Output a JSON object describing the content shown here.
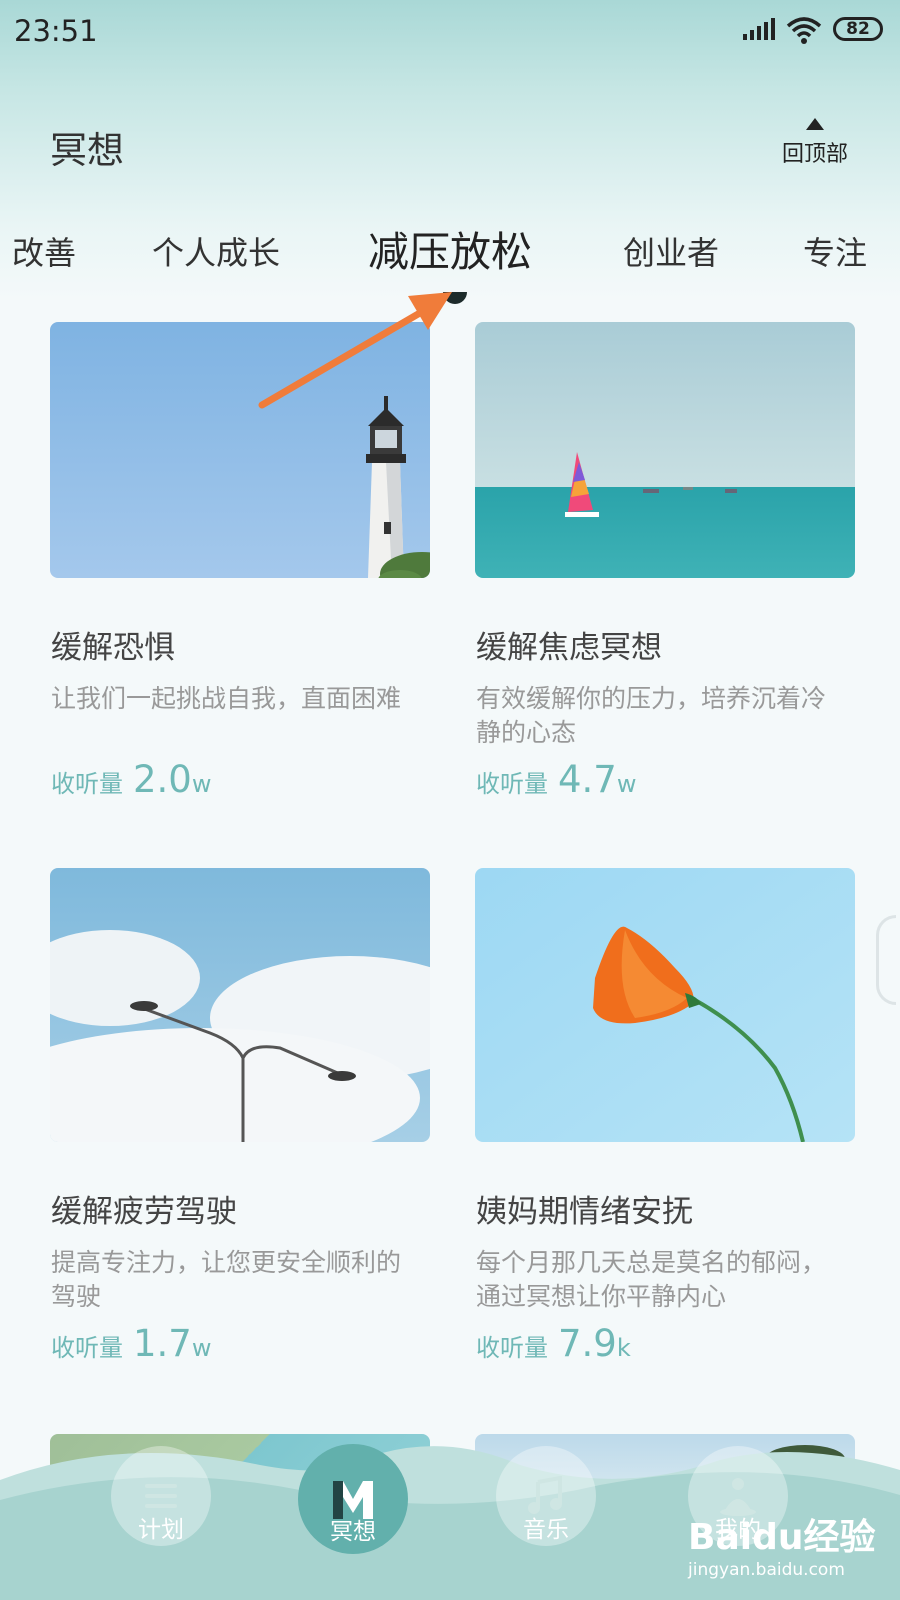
{
  "status_bar": {
    "time": "23:51",
    "battery": "82"
  },
  "header": {
    "title": "冥想",
    "back_to_top": "回顶部"
  },
  "tabs": [
    {
      "label": "改善"
    },
    {
      "label": "个人成长"
    },
    {
      "label": "减压放松",
      "active": true
    },
    {
      "label": "创业者"
    },
    {
      "label": "专注"
    }
  ],
  "cards": [
    {
      "title": "缓解恐惧",
      "desc": "让我们一起挑战自我，直面困难",
      "count_label": "收听量",
      "count_value": "2.0",
      "count_unit": "w",
      "image": "lighthouse"
    },
    {
      "title": "缓解焦虑冥想",
      "desc": "有效缓解你的压力，培养沉着冷静的心态",
      "count_label": "收听量",
      "count_value": "4.7",
      "count_unit": "w",
      "image": "sailboat"
    },
    {
      "title": "缓解疲劳驾驶",
      "desc": "提高专注力，让您更安全顺利的驾驶",
      "count_label": "收听量",
      "count_value": "1.7",
      "count_unit": "w",
      "image": "streetlamp"
    },
    {
      "title": "姨妈期情绪安抚",
      "desc": "每个月那几天总是莫名的郁闷，通过冥想让你平静内心",
      "count_label": "收听量",
      "count_value": "7.9",
      "count_unit": "k",
      "image": "poppy-flower"
    }
  ],
  "bottom_nav": [
    {
      "label": "计划",
      "icon": "menu-icon"
    },
    {
      "label": "冥想",
      "icon": "m-logo-icon",
      "active": true
    },
    {
      "label": "音乐",
      "icon": "music-note-icon"
    },
    {
      "label": "我的",
      "icon": "meditation-person-icon"
    }
  ],
  "watermark": {
    "brand": "Baidu经验",
    "url": "jingyan.baidu.com"
  },
  "colors": {
    "accent": "#6fb8b6",
    "header_bg": "#a9d8d6",
    "nav_active": "#62b0ac",
    "annotation_arrow": "#f07c3a"
  }
}
